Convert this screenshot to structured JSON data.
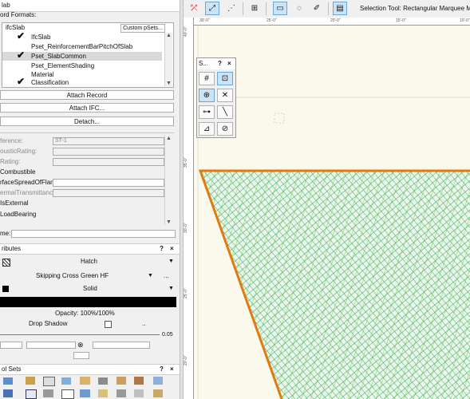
{
  "data_panel": {
    "title": "lab",
    "record_formats_label": "ord Formats:",
    "ifcslab_label": "ifcSlab",
    "custom_psets_button": "Custom pSets...",
    "records": [
      {
        "label": "IfcSlab",
        "checked": true
      },
      {
        "label": "Pset_ReinforcementBarPitchOfSlab",
        "checked": false
      },
      {
        "label": "Pset_SlabCommon",
        "checked": true,
        "selected": true
      },
      {
        "label": "Pset_ElementShading",
        "checked": false
      },
      {
        "label": "Material",
        "checked": false
      },
      {
        "label": "Classification",
        "checked": true
      }
    ],
    "attach_record_button": "Attach Record",
    "attach_ifc_button": "Attach IFC...",
    "detach_button": "Detach...",
    "fields": [
      {
        "label": "ference:",
        "value": "ST-1",
        "enabled": false
      },
      {
        "label": "ousticRating:",
        "value": "",
        "enabled": false
      },
      {
        "label": "Rating:",
        "value": "",
        "enabled": false
      },
      {
        "label": "Combustible",
        "value": null,
        "enabled": true
      },
      {
        "label": "rfaceSpreadOfFlame:",
        "value": "",
        "enabled": true
      },
      {
        "label": "ermalTransmittance:",
        "value": "",
        "enabled": false
      },
      {
        "label": "IsExternal",
        "value": null,
        "enabled": true
      },
      {
        "label": "LoadBearing",
        "value": null,
        "enabled": true
      }
    ],
    "name_label": "me:"
  },
  "attributes_panel": {
    "title": "ributes",
    "help_label": "?",
    "close_label": "×",
    "fill_style": "Hatch",
    "hatch_name": "Skipping Cross Green HF",
    "more_label": "...",
    "pen_style": "Solid",
    "opacity_label": "Opacity: 100%/100%",
    "drop_shadow_label": "Drop Shadow",
    "line_weight": "0.05"
  },
  "toolsets_panel": {
    "title": "ol Sets",
    "help_label": "?",
    "close_label": "×"
  },
  "toolbar": {
    "status_text": "Selection Tool: Rectangular Marquee Mode"
  },
  "ruler": {
    "h_labels": [
      "30'-0\"",
      "25'-0\"",
      "20'-0\"",
      "15'-0\"",
      "10'-0\""
    ],
    "v_labels": [
      "40'-0\"",
      "35'-0\"",
      "30'-0\"",
      "25'-0\"",
      "20'-0\""
    ]
  },
  "snap_palette": {
    "title": "S...",
    "help_label": "?",
    "close_label": "×"
  },
  "colors": {
    "hatch_green": "#3cb371",
    "slab_outline": "#e07b10",
    "canvas_bg": "#fbf8ec",
    "active_blue": "#cde4f7"
  }
}
